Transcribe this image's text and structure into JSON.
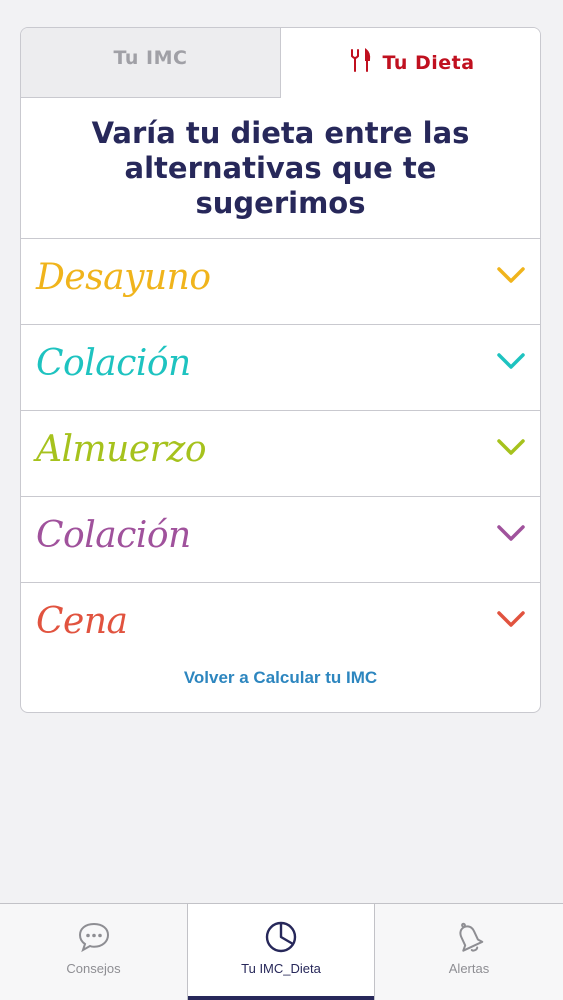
{
  "tabs": {
    "imc_label": "Tu IMC",
    "dieta_label": "Tu Dieta",
    "active_color": "#c0101f"
  },
  "heading": "Varía tu dieta entre las alternativas que te sugerimos",
  "meals": [
    {
      "label": "Desayuno",
      "color": "#f0b41c"
    },
    {
      "label": "Colación",
      "color": "#1ec3c0"
    },
    {
      "label": "Almuerzo",
      "color": "#a6c21d"
    },
    {
      "label": "Colación",
      "color": "#a0529c"
    },
    {
      "label": "Cena",
      "color": "#e1533f"
    }
  ],
  "recalc_link": "Volver a Calcular tu IMC",
  "tabbar": {
    "items": [
      {
        "label": "Consejos",
        "icon": "chat-bubble-icon"
      },
      {
        "label": "Tu IMC_Dieta",
        "icon": "pie-chart-icon",
        "active": true
      },
      {
        "label": "Alertas",
        "icon": "bell-icon"
      }
    ]
  }
}
